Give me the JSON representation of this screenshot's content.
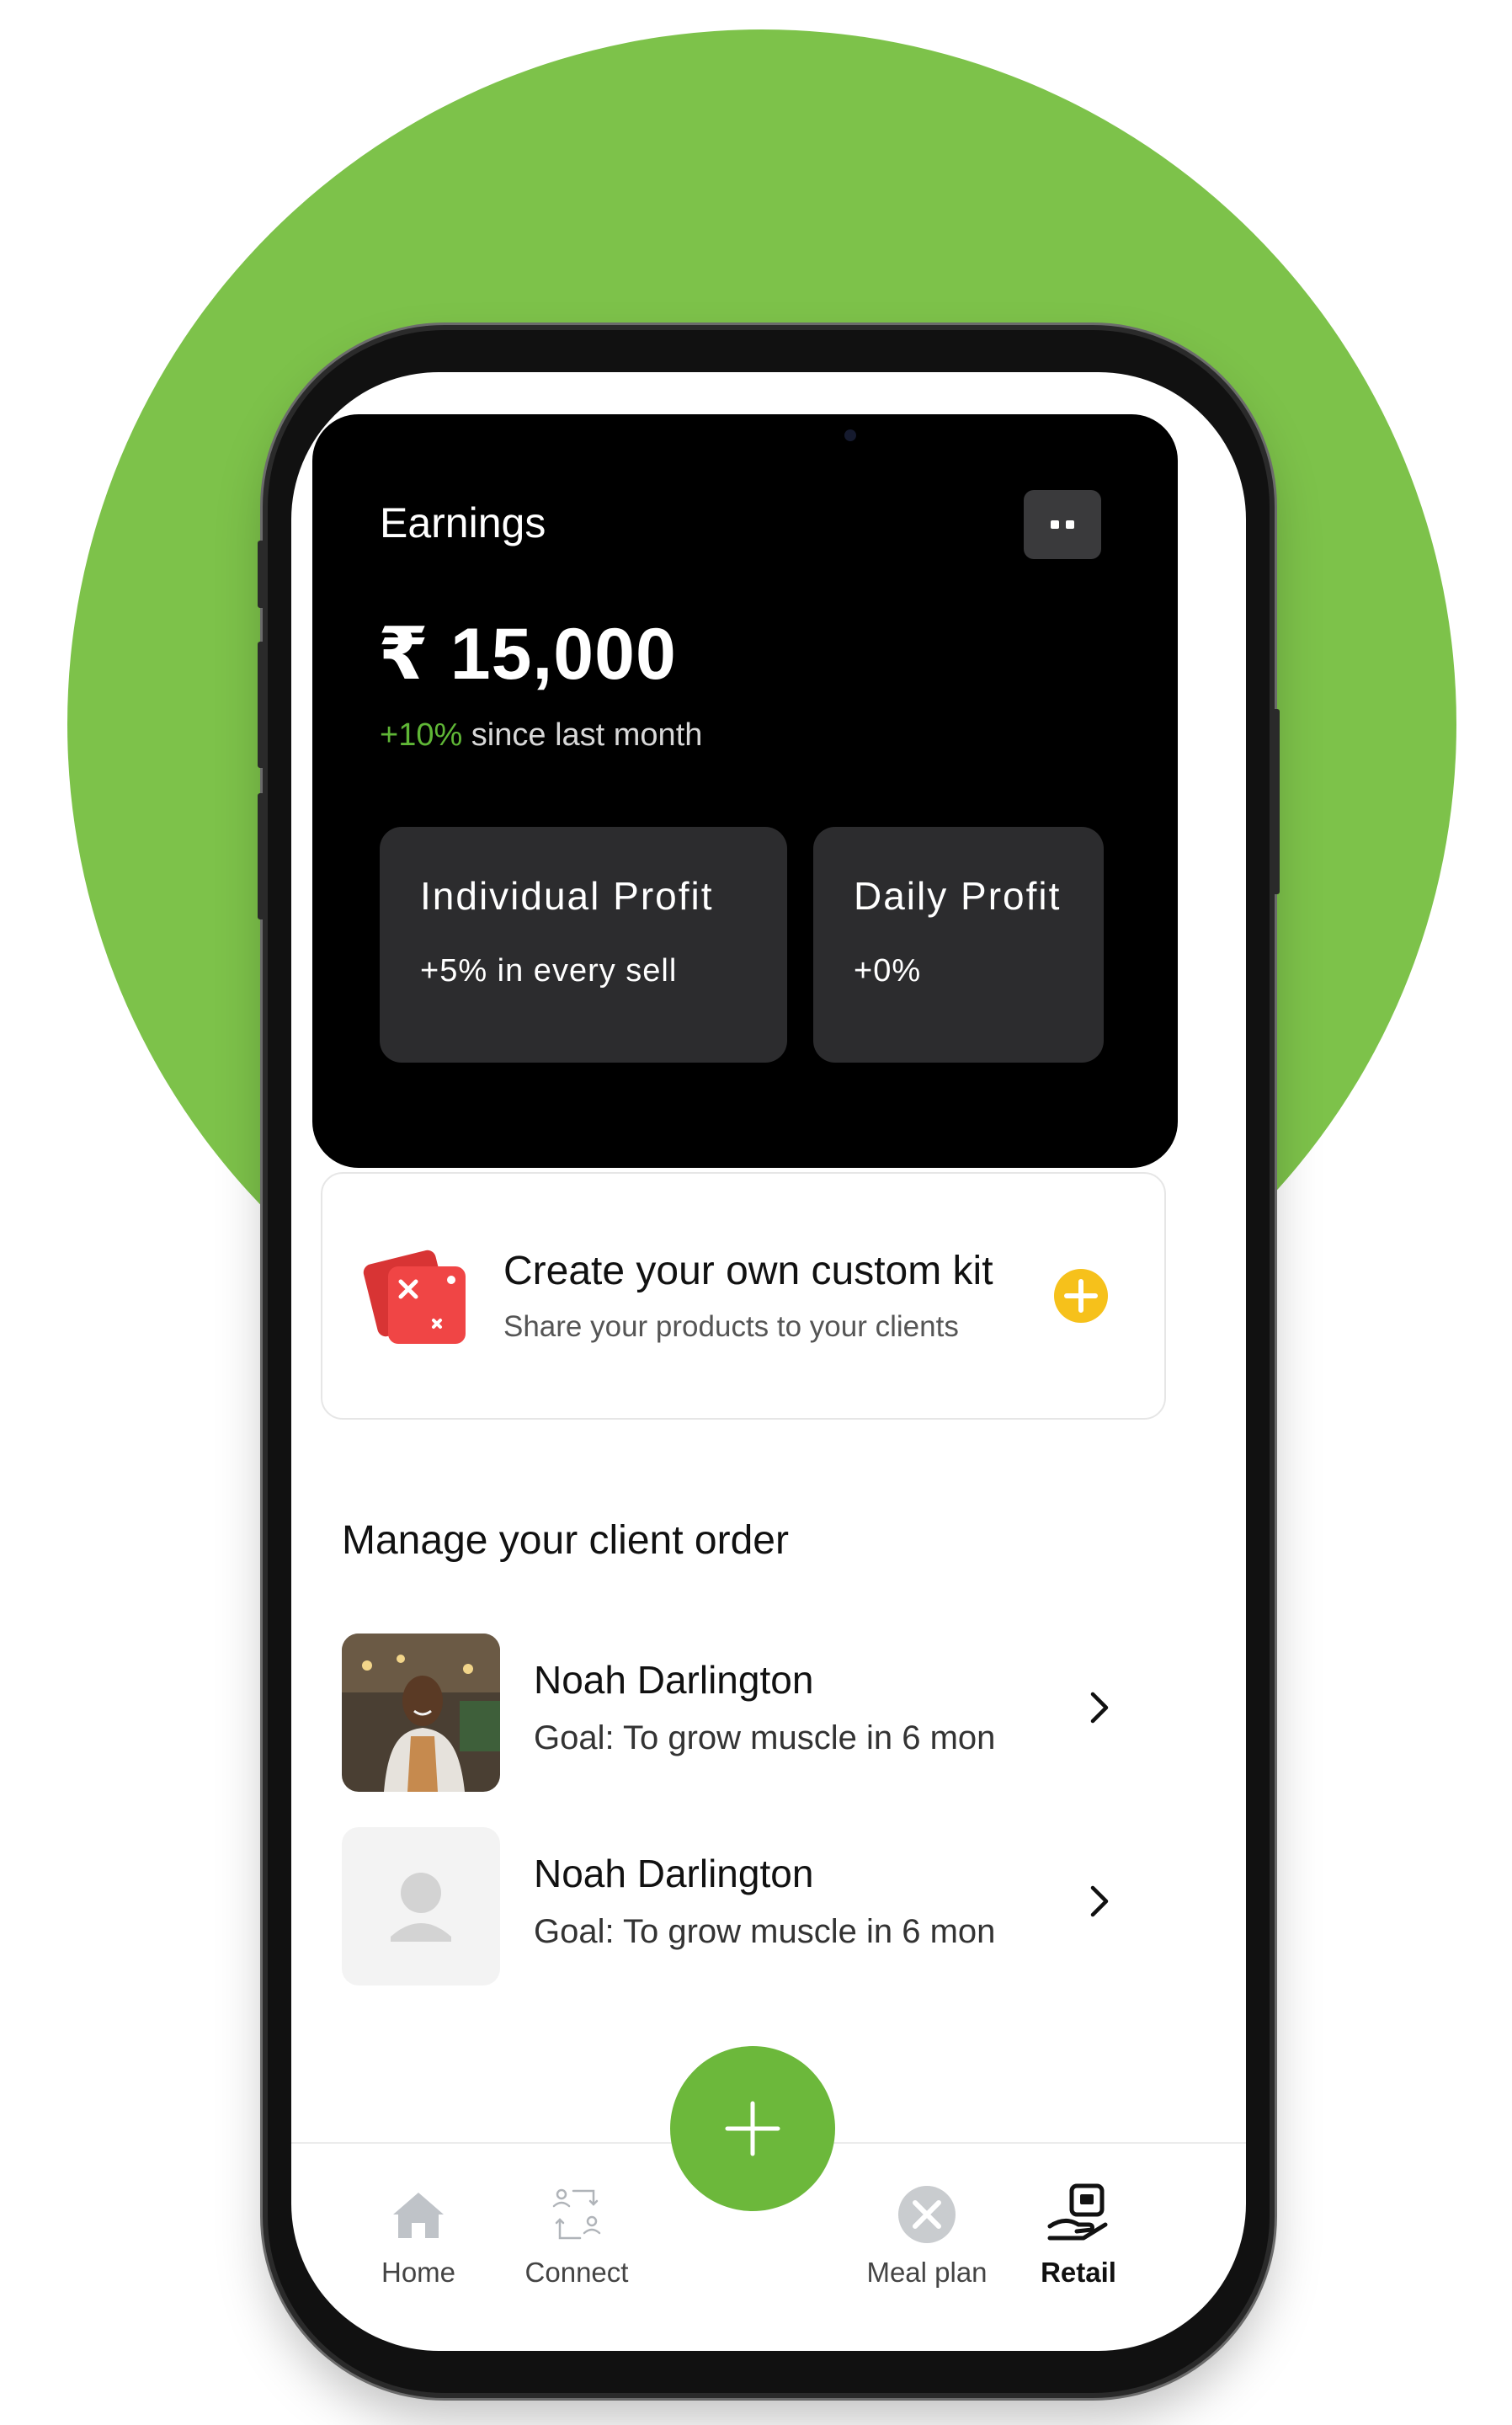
{
  "earnings": {
    "title": "Earnings",
    "currency_symbol": "₹",
    "amount": "15,000",
    "growth_value": "+10%",
    "growth_text": " since last month"
  },
  "stats": [
    {
      "title": "Individual Profit",
      "subtitle": "+5% in every sell"
    },
    {
      "title": "Daily Profit",
      "subtitle": "+0%"
    }
  ],
  "custom_kit": {
    "title": "Create your own custom kit",
    "subtitle": "Share your products to your clients"
  },
  "orders": {
    "section_title": "Manage your client order",
    "clients": [
      {
        "name": "Noah Darlington",
        "goal": "Goal: To grow muscle in 6 mon",
        "avatar": "photo"
      },
      {
        "name": "Noah Darlington",
        "goal": "Goal: To grow muscle in 6 mon",
        "avatar": "placeholder"
      }
    ]
  },
  "bottom_nav": {
    "items": [
      {
        "label": "Home",
        "icon": "home-icon"
      },
      {
        "label": "Connect",
        "icon": "connect-icon"
      },
      {
        "label": "Meal plan",
        "icon": "meal-plan-icon"
      },
      {
        "label": "Retail",
        "icon": "retail-icon",
        "active": true
      }
    ],
    "fab_icon": "plus-icon"
  },
  "colors": {
    "background_circle": "#7dc24a",
    "accent_green": "#6cb83b",
    "growth_green": "#5fb636",
    "kit_red": "#f04545",
    "plus_yellow": "#f6c11b"
  }
}
